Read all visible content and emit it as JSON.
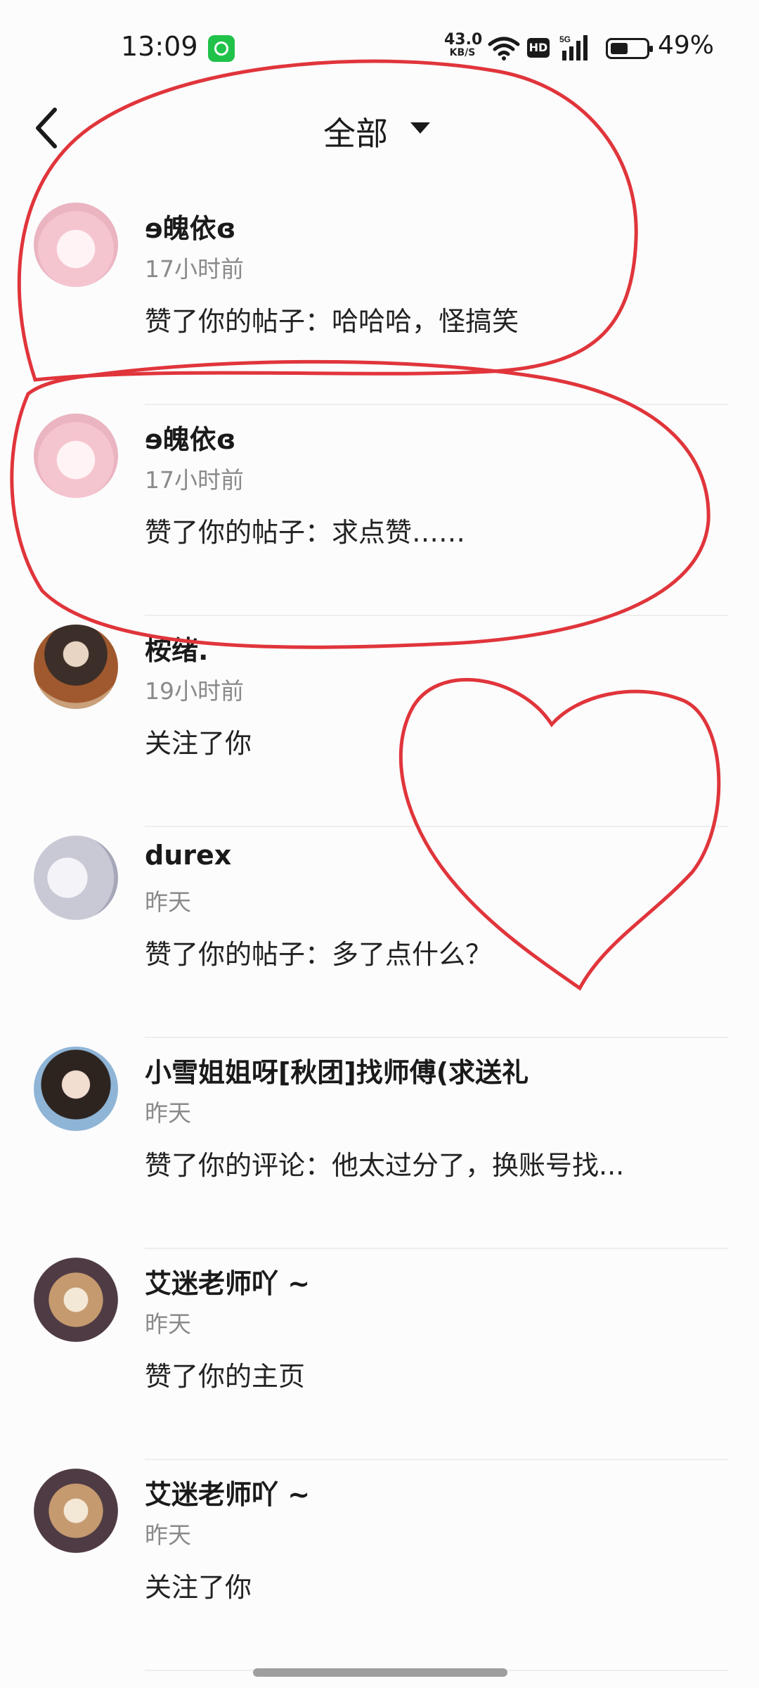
{
  "status_bar": {
    "time": "13:09",
    "net_speed": "43.0",
    "net_unit": "KB/S",
    "hd": "HD",
    "battery_text": "49%",
    "battery_level": 0.49
  },
  "header": {
    "title": "全部",
    "back_icon": "chevron-left-icon",
    "dropdown_icon": "caret-down-icon"
  },
  "notifications": [
    {
      "name": "ɘ魄依ɞ",
      "time": "17小时前",
      "action": "赞了你的帖子：哈哈哈，怪搞笑"
    },
    {
      "name": "ɘ魄依ɞ",
      "time": "17小时前",
      "action": "赞了你的帖子：求点赞……"
    },
    {
      "name": "桉绪.",
      "time": "19小时前",
      "action": "关注了你"
    },
    {
      "name": "durex",
      "time": "昨天",
      "action": "赞了你的帖子：多了点什么？"
    },
    {
      "name": "小雪姐姐呀[秋团]找师傅(求送礼",
      "time": "昨天",
      "action": "赞了你的评论：他太过分了，换账号找..."
    },
    {
      "name": "艾迷老师吖 ~",
      "time": "昨天",
      "action": "赞了你的主页"
    },
    {
      "name": "艾迷老师吖 ~",
      "time": "昨天",
      "action": "关注了你"
    }
  ],
  "colors": {
    "annotation_red": "#e0353b",
    "background": "#fcfcfd",
    "secondary_text": "#8a8a8a"
  }
}
